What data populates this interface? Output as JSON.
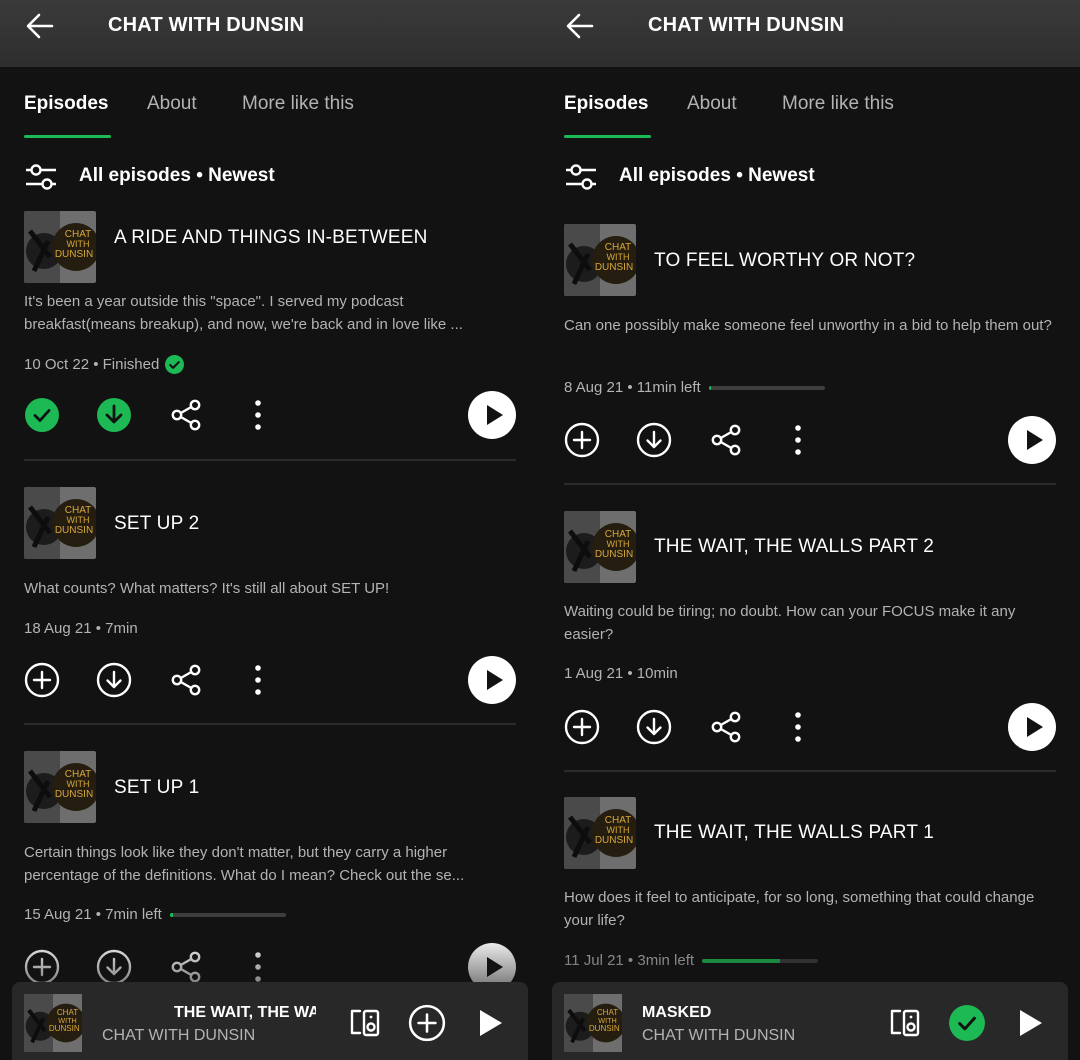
{
  "colors": {
    "accent": "#1db954",
    "background": "#121212",
    "topbar": "#333333",
    "text_secondary": "#b3b3b3"
  },
  "left": {
    "header": {
      "title": "CHAT WITH DUNSIN",
      "back_icon": "arrow-left-icon"
    },
    "tabs": [
      {
        "label": "Episodes",
        "active": true
      },
      {
        "label": "About"
      },
      {
        "label": "More like this"
      }
    ],
    "filter": {
      "label": "All episodes • Newest",
      "icon": "sliders-icon"
    },
    "episodes": [
      {
        "title": "A RIDE AND THINGS IN-BETWEEN",
        "description": "It's been a year outside this \"space\". I served my podcast breakfast(means breakup), and now, we're back and in love like ...",
        "meta": "10 Oct 22 • Finished",
        "status": "finished",
        "added": true,
        "downloaded": true
      },
      {
        "title": "SET UP 2",
        "description": "What counts? What matters? It's still all about SET UP!",
        "meta": "18 Aug 21 • 7min"
      },
      {
        "title": "SET UP 1",
        "description": "Certain things look like they don't matter, but they carry a higher percentage of the definitions. What do I mean? Check out the se...",
        "meta": "15 Aug 21 • 7min left",
        "progress": 0.03
      }
    ],
    "thumb_text": "CHAT WITH DUNSIN",
    "mini_player": {
      "title": "THE WAIT, THE WA",
      "subtitle": "CHAT WITH DUNSIN"
    }
  },
  "right": {
    "header": {
      "title": "CHAT WITH DUNSIN",
      "back_icon": "arrow-left-icon"
    },
    "tabs": [
      {
        "label": "Episodes",
        "active": true
      },
      {
        "label": "About"
      },
      {
        "label": "More like this"
      }
    ],
    "filter": {
      "label": "All episodes • Newest",
      "icon": "sliders-icon"
    },
    "episodes": [
      {
        "title": "TO FEEL WORTHY OR NOT?",
        "description": "Can one possibly make someone feel unworthy in a bid to help them out?",
        "meta": "8 Aug 21 • 11min left",
        "progress": 0.02
      },
      {
        "title": "THE WAIT, THE WALLS PART 2",
        "description": "Waiting could be tiring; no doubt. How can your FOCUS make it any easier?",
        "meta": "1 Aug 21 • 10min"
      },
      {
        "title": "THE WAIT, THE WALLS PART 1",
        "description": "How does it feel to anticipate, for so long, something that could change your life?",
        "meta": "11 Jul 21 • 3min left",
        "progress": 0.67
      }
    ],
    "thumb_text": "CHAT WITH DUNSIN",
    "mini_player": {
      "title": "MASKED",
      "subtitle": "CHAT WITH DUNSIN",
      "added": true
    }
  }
}
